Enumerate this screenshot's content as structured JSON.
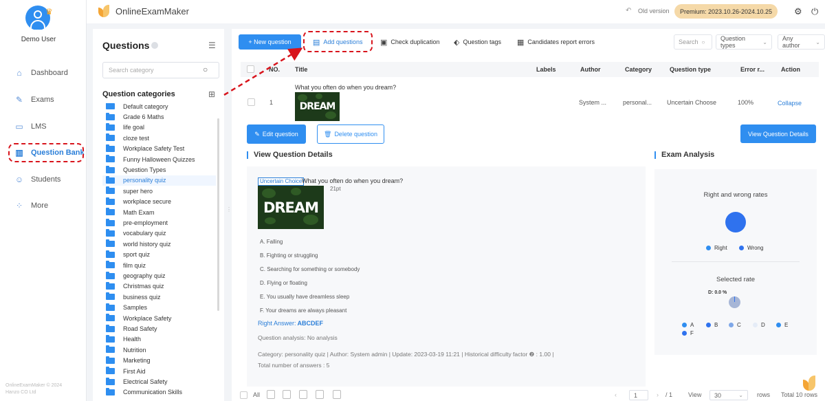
{
  "user": {
    "name": "Demo User"
  },
  "nav": [
    {
      "id": "dashboard",
      "label": "Dashboard",
      "icon": "home-icon"
    },
    {
      "id": "exams",
      "label": "Exams",
      "icon": "pencil-icon"
    },
    {
      "id": "lms",
      "label": "LMS",
      "icon": "book-icon"
    },
    {
      "id": "question-bank",
      "label": "Question Bank",
      "icon": "bar-chart-icon",
      "active": true
    },
    {
      "id": "students",
      "label": "Students",
      "icon": "user-icon"
    },
    {
      "id": "more",
      "label": "More",
      "icon": "grid-icon"
    }
  ],
  "copyright": {
    "line1": "OnlineExamMaker © 2024",
    "line2": "Hanzo CO Ltd"
  },
  "header": {
    "brand": "OnlineExamMaker",
    "old_version": "Old version",
    "premium_label": "Premium:",
    "premium_range": "2023.10.26-2024.10.25"
  },
  "categories_panel": {
    "title": "Questions",
    "search_placeholder": "Search category",
    "heading": "Question categories",
    "items": [
      "Default category",
      "Grade 6 Maths",
      "life goal",
      "cloze test",
      "Workplace Safety Test",
      "Funny Halloween Quizzes",
      "Question Types",
      "personality quiz",
      "super hero",
      "workplace secure",
      "Math Exam",
      "pre-employment",
      "vocabulary quiz",
      "world history quiz",
      "sport quiz",
      "film quiz",
      "geography quiz",
      "Christmas quiz",
      "business quiz",
      "Samples",
      "Workplace Safety",
      "Road Safety",
      "Health",
      "Nutrition",
      "Marketing",
      "First Aid",
      "Electrical Safety",
      "Communication Skills"
    ],
    "active_item": "personality quiz"
  },
  "toolbar": {
    "new_question": "+ New question",
    "add_questions": "Add questions",
    "check_duplication": "Check duplication",
    "question_tags": "Question tags",
    "candidates_report": "Candidates report errors",
    "search_placeholder": "Search",
    "question_types": "Question types",
    "any_author": "Any author"
  },
  "table": {
    "headers": {
      "no": "NO.",
      "title": "Title",
      "labels": "Labels",
      "author": "Author",
      "category": "Category",
      "type": "Question type",
      "error": "Error r...",
      "action": "Action"
    },
    "row": {
      "no": "1",
      "title": "What you often do when you dream?",
      "author": "System ...",
      "category": "personal...",
      "type": "Uncertain Choose",
      "error_rate": "100%",
      "action": "Collapse"
    }
  },
  "image_text": "DREAM",
  "actions": {
    "edit": "Edit question",
    "delete": "Delete question",
    "view": "View Question Details"
  },
  "details": {
    "title": "View Question Details",
    "tag": "Uncertain Choice",
    "question": "What you often do when you dream?",
    "points": "21pt",
    "options": [
      "A. Falling",
      "B. Fighting or struggling",
      "C. Searching for something or somebody",
      "D. Flying or floating",
      "E. You usually have dreamless sleep",
      "F. Your dreams are always pleasant"
    ],
    "right_answer_label": "Right Answer:",
    "right_answer": "ABCDEF",
    "analysis": "Question analysis: No analysis",
    "meta": "Category: personality quiz | Author: System admin | Update: 2023-03-19 11:21 | Historical difficulty factor ❷ :  1.00 |",
    "total_answers": "Total number of answers :  5"
  },
  "exam_analysis": {
    "title": "Exam Analysis",
    "rates_title": "Right and wrong rates",
    "right": "Right",
    "wrong": "Wrong",
    "selected_title": "Selected rate",
    "pie_label": "D: 0.0 %",
    "legend": [
      "A",
      "B",
      "C",
      "D",
      "E",
      "F"
    ],
    "colors": {
      "right": "#2f8ef0",
      "wrong": "#2f72ee",
      "a": "#2f8ef0",
      "b": "#2f72ee",
      "c": "#7fa8e8",
      "d": "#e5ecf7",
      "e": "#2f8ef0",
      "f": "#2f72ee"
    }
  },
  "footer": {
    "all": "All",
    "page": "1",
    "of": "/ 1",
    "view": "View",
    "per_page": "30",
    "rows": "rows",
    "total": "Total 10 rows"
  }
}
